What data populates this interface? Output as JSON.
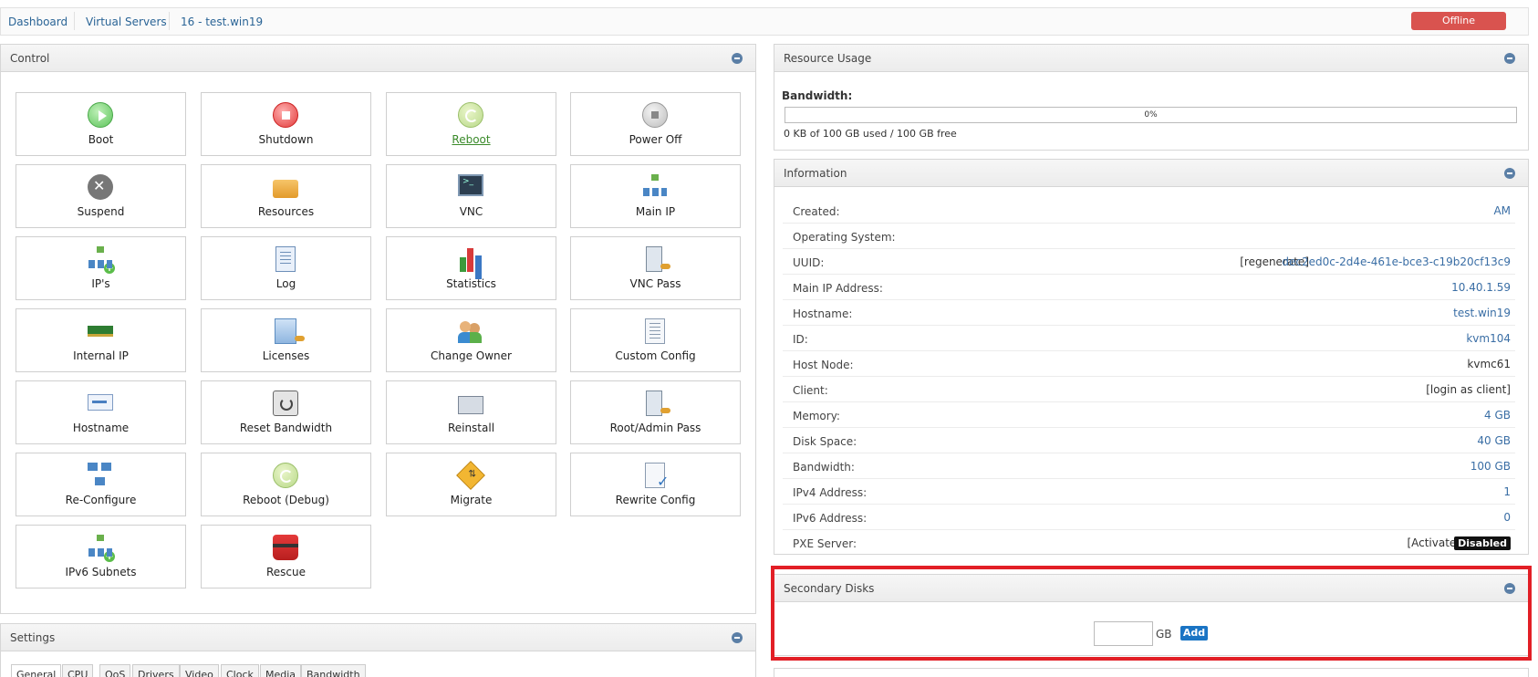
{
  "breadcrumb": [
    "Dashboard",
    "Virtual Servers",
    "16 - test.win19"
  ],
  "status": {
    "label": "Offline",
    "color": "#d9534f"
  },
  "control": {
    "title": "Control",
    "tiles": [
      {
        "label": "Boot",
        "icon": "play-icon"
      },
      {
        "label": "Shutdown",
        "icon": "stop-icon"
      },
      {
        "label": "Reboot",
        "icon": "reboot-icon"
      },
      {
        "label": "Power Off",
        "icon": "power-off-icon"
      },
      {
        "label": "Suspend",
        "icon": "suspend-icon"
      },
      {
        "label": "Resources",
        "icon": "resources-icon"
      },
      {
        "label": "VNC",
        "icon": "terminal-icon"
      },
      {
        "label": "Main IP",
        "icon": "network-icon"
      },
      {
        "label": "IP's",
        "icon": "network-add-icon"
      },
      {
        "label": "Log",
        "icon": "log-icon"
      },
      {
        "label": "Statistics",
        "icon": "bar-chart-icon"
      },
      {
        "label": "VNC Pass",
        "icon": "vnc-password-icon"
      },
      {
        "label": "Internal IP",
        "icon": "network-card-icon"
      },
      {
        "label": "Licenses",
        "icon": "license-icon"
      },
      {
        "label": "Change Owner",
        "icon": "users-icon"
      },
      {
        "label": "Custom Config",
        "icon": "config-document-icon"
      },
      {
        "label": "Hostname",
        "icon": "hostname-icon"
      },
      {
        "label": "Reset Bandwidth",
        "icon": "reset-icon"
      },
      {
        "label": "Reinstall",
        "icon": "reinstall-icon"
      },
      {
        "label": "Root/Admin Pass",
        "icon": "root-password-icon"
      },
      {
        "label": "Re-Configure",
        "icon": "reconfigure-icon"
      },
      {
        "label": "Reboot (Debug)",
        "icon": "reboot-debug-icon"
      },
      {
        "label": "Migrate",
        "icon": "migrate-icon"
      },
      {
        "label": "Rewrite Config",
        "icon": "rewrite-config-icon"
      },
      {
        "label": "IPv6 Subnets",
        "icon": "ipv6-network-icon"
      },
      {
        "label": "Rescue",
        "icon": "life-vest-icon"
      }
    ]
  },
  "resource_usage": {
    "title": "Resource Usage",
    "bandwidth_label": "Bandwidth:",
    "percent_text": "0%",
    "percent_value": 0,
    "usage_text": "0 KB of 100 GB used / 100 GB free"
  },
  "information": {
    "title": "Information",
    "created_label": "Created:",
    "created_value": "AM",
    "os_label": "Operating System:",
    "uuid_label": "UUID:",
    "uuid_regenerate": "[regenerate]",
    "uuid_value": "dec2ed0c-2d4e-461e-bce3-c19b20cf13c9",
    "main_ip_label": "Main IP Address:",
    "main_ip_value": "10.40.1.59",
    "hostname_label": "Hostname:",
    "hostname_value": "test.win19",
    "id_label": "ID:",
    "id_value": "kvm104",
    "host_node_label": "Host Node:",
    "host_node_value": "kvmc61",
    "client_label": "Client:",
    "client_value": "[login as client]",
    "memory_label": "Memory:",
    "memory_value": "4 GB",
    "disk_label": "Disk Space:",
    "disk_value": "40 GB",
    "bandwidth_label": "Bandwidth:",
    "bandwidth_value": "100 GB",
    "ipv4_label": "IPv4 Address:",
    "ipv4_value": "1",
    "ipv6_label": "IPv6 Address:",
    "ipv6_value": "0",
    "pxe_label": "PXE Server:",
    "pxe_activate": "[Activate]",
    "pxe_status": "Disabled"
  },
  "secondary_disks": {
    "title": "Secondary Disks",
    "size_value": "",
    "unit_label": "GB",
    "add_label": "Add"
  },
  "settings": {
    "title": "Settings",
    "tabs": [
      "General",
      "CPU",
      "QoS",
      "Drivers",
      "Video",
      "Clock",
      "Media",
      "Bandwidth"
    ]
  },
  "accent_colors": {
    "link": "#2a6496",
    "offline": "#d9534f",
    "highlight": "#e21f26",
    "add_button": "#1a74c4"
  }
}
